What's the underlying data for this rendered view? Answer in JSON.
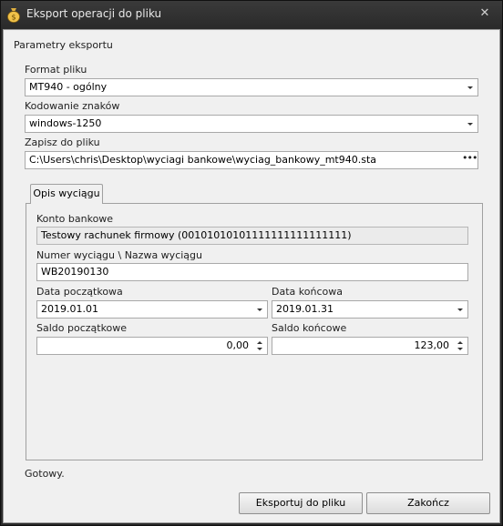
{
  "window": {
    "title": "Eksport operacji do pliku",
    "close_glyph": "✕"
  },
  "section": {
    "title": "Parametry eksportu"
  },
  "format": {
    "label": "Format pliku",
    "value": "MT940 - ogólny"
  },
  "encoding": {
    "label": "Kodowanie znaków",
    "value": "windows-1250"
  },
  "save_to": {
    "label": "Zapisz do pliku",
    "value": "C:\\Users\\chris\\Desktop\\wyciagi bankowe\\wyciag_bankowy_mt940.sta",
    "browse_glyph": "•••"
  },
  "tab": {
    "label": "Opis wyciągu"
  },
  "account": {
    "label": "Konto bankowe",
    "value": "Testowy rachunek firmowy (00101010101111111111111111)"
  },
  "statement": {
    "label": "Numer wyciągu \\ Nazwa wyciągu",
    "value": "WB20190130"
  },
  "date_start": {
    "label": "Data początkowa",
    "value": "2019.01.01"
  },
  "date_end": {
    "label": "Data końcowa",
    "value": "2019.01.31"
  },
  "balance_start": {
    "label": "Saldo początkowe",
    "value": "0,00"
  },
  "balance_end": {
    "label": "Saldo końcowe",
    "value": "123,00"
  },
  "status": {
    "text": "Gotowy."
  },
  "buttons": {
    "export": "Eksportuj do pliku",
    "close": "Zakończ"
  },
  "icons": {
    "title": "money-bag-icon"
  },
  "colors": {
    "titlebar": "#2b2b2b",
    "client": "#f0f0f0",
    "readonly_field": "#ebebeb"
  }
}
